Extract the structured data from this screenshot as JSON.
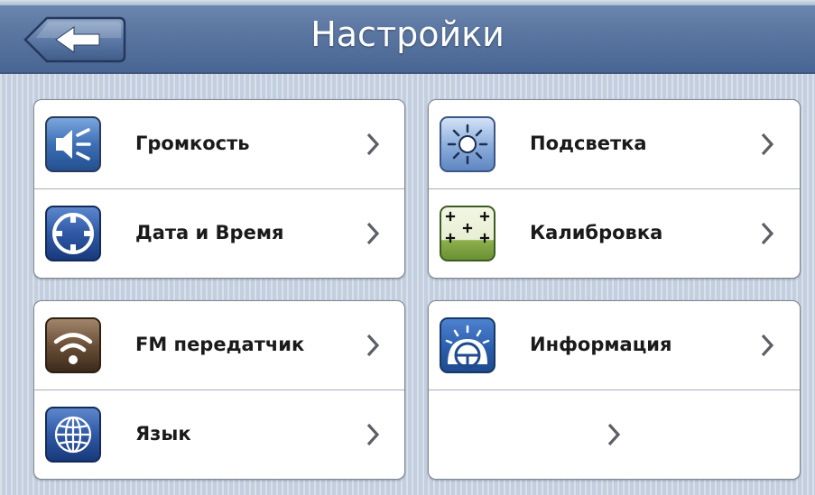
{
  "header": {
    "title": "Настройки",
    "back_icon": "arrow-left-icon"
  },
  "groups": [
    {
      "items": [
        {
          "label": "Громкость",
          "icon": "speaker-icon"
        },
        {
          "label": "Дата и Время",
          "icon": "clock-icon"
        }
      ]
    },
    {
      "items": [
        {
          "label": "Подсветка",
          "icon": "sun-icon"
        },
        {
          "label": "Калибровка",
          "icon": "calibration-icon"
        }
      ]
    },
    {
      "items": [
        {
          "label": "FM передатчик",
          "icon": "wifi-signal-icon"
        },
        {
          "label": "Язык",
          "icon": "globe-icon"
        }
      ]
    },
    {
      "items": [
        {
          "label": "Информация",
          "icon": "dial-icon"
        },
        {
          "label": "",
          "icon": ""
        }
      ]
    }
  ],
  "colors": {
    "header": "#5a76a1",
    "background": "#c3cfdf",
    "panel": "#ffffff",
    "text": "#1a1a1a",
    "chevron": "#5c5f66"
  }
}
